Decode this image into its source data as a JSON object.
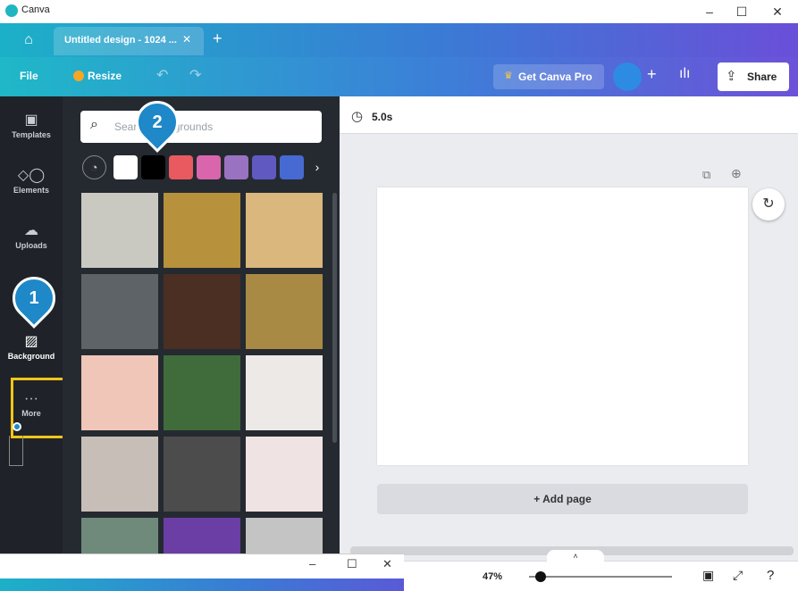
{
  "window": {
    "title": "Canva",
    "min": "–",
    "max": "☐",
    "close": "✕"
  },
  "tabs": {
    "home_icon": "home-icon",
    "active_label": "Untitled design - 1024 ...",
    "close": "✕",
    "add": "+"
  },
  "toolbar": {
    "file": "File",
    "resize": "Resize",
    "undo": "↶",
    "redo": "↷",
    "get_pro": "Get Canva Pro",
    "crown": "♛",
    "add_member": "+",
    "insights": "ılı",
    "share": "Share",
    "share_icon": "⇪"
  },
  "sidebar": {
    "items": [
      {
        "label": "Templates",
        "icon": "▣"
      },
      {
        "label": "Elements",
        "icon": "◇◯"
      },
      {
        "label": "Uploads",
        "icon": "☁"
      },
      {
        "label": "Background",
        "icon": "▨"
      },
      {
        "label": "More",
        "icon": "···"
      }
    ]
  },
  "panel": {
    "search_placeholder": "Search backgrounds",
    "palette_icon": "palette-icon",
    "palette_glyph": "◔",
    "next": "›",
    "swatches": [
      "#ffffff",
      "#000000",
      "#e85a5f",
      "#d966ad",
      "#9a72c2",
      "#6159c2",
      "#4669d2"
    ],
    "tiles": [
      "#c9c9c2",
      "#b7913b",
      "#dab77c",
      "#5d6366",
      "#4a2f22",
      "#a98a45",
      "#f0c6b8",
      "#3f6c3a",
      "#ece9e7",
      "#c7bfb7",
      "#4c4c4c",
      "#efe4e3",
      "#6f8a7a",
      "#6b3ea6",
      "#c4c4c4"
    ],
    "collapse": "‹"
  },
  "callouts": {
    "one": "1",
    "two": "2"
  },
  "canvas": {
    "time": "5.0s",
    "clock_icon": "clock-icon",
    "copy_glyph": "⧉",
    "addpage_glyph": "⊕",
    "refresh_glyph": "↻",
    "add_page": "+ Add page"
  },
  "bottom": {
    "expand": "˄",
    "zoom": "47%",
    "pages_glyph": "▣",
    "fullscreen_glyph": "⤢",
    "help_glyph": "?"
  },
  "sub_window": {
    "min": "–",
    "max": "☐",
    "close": "✕"
  }
}
